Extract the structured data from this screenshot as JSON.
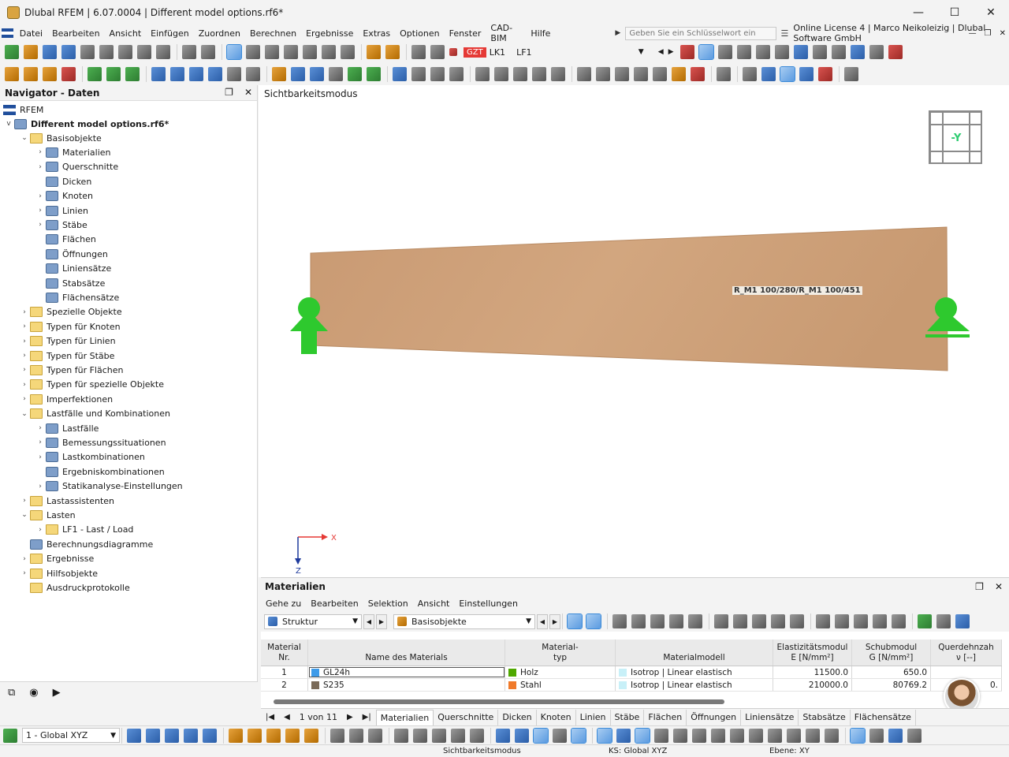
{
  "window": {
    "title": "Dlubal RFEM | 6.07.0004 | Different model options.rf6*",
    "controls": [
      "—",
      "☐",
      "✕"
    ]
  },
  "menu": {
    "items": [
      "Datei",
      "Bearbeiten",
      "Ansicht",
      "Einfügen",
      "Zuordnen",
      "Berechnen",
      "Ergebnisse",
      "Extras",
      "Optionen",
      "Fenster",
      "CAD-BIM",
      "Hilfe"
    ],
    "search_placeholder": "Geben Sie ein Schlüsselwort ein (Alt+Q)",
    "license": "Online License 4 | Marco Neikoleizig | Dlubal Software GmbH"
  },
  "toolbar": {
    "load_badge": "GZT",
    "load_case": "LK1",
    "load_name": "LF1"
  },
  "navigator": {
    "title": "Navigator - Daten",
    "root": "RFEM",
    "model": "Different model options.rf6*",
    "items": [
      {
        "label": "Basisobjekte",
        "level": 1,
        "chev": "v",
        "icon": "folder"
      },
      {
        "label": "Materialien",
        "level": 2,
        "chev": ">",
        "icon": "object"
      },
      {
        "label": "Querschnitte",
        "level": 2,
        "chev": ">",
        "icon": "object"
      },
      {
        "label": "Dicken",
        "level": 2,
        "chev": "",
        "icon": "object"
      },
      {
        "label": "Knoten",
        "level": 2,
        "chev": ">",
        "icon": "object"
      },
      {
        "label": "Linien",
        "level": 2,
        "chev": ">",
        "icon": "object"
      },
      {
        "label": "Stäbe",
        "level": 2,
        "chev": ">",
        "icon": "object"
      },
      {
        "label": "Flächen",
        "level": 2,
        "chev": "",
        "icon": "object"
      },
      {
        "label": "Öffnungen",
        "level": 2,
        "chev": "",
        "icon": "object"
      },
      {
        "label": "Liniensätze",
        "level": 2,
        "chev": "",
        "icon": "object"
      },
      {
        "label": "Stabsätze",
        "level": 2,
        "chev": "",
        "icon": "object"
      },
      {
        "label": "Flächensätze",
        "level": 2,
        "chev": "",
        "icon": "object"
      },
      {
        "label": "Spezielle Objekte",
        "level": 1,
        "chev": ">",
        "icon": "folder"
      },
      {
        "label": "Typen für Knoten",
        "level": 1,
        "chev": ">",
        "icon": "folder"
      },
      {
        "label": "Typen für Linien",
        "level": 1,
        "chev": ">",
        "icon": "folder"
      },
      {
        "label": "Typen für Stäbe",
        "level": 1,
        "chev": ">",
        "icon": "folder"
      },
      {
        "label": "Typen für Flächen",
        "level": 1,
        "chev": ">",
        "icon": "folder"
      },
      {
        "label": "Typen für spezielle Objekte",
        "level": 1,
        "chev": ">",
        "icon": "folder"
      },
      {
        "label": "Imperfektionen",
        "level": 1,
        "chev": ">",
        "icon": "folder"
      },
      {
        "label": "Lastfälle und Kombinationen",
        "level": 1,
        "chev": "v",
        "icon": "folder"
      },
      {
        "label": "Lastfälle",
        "level": 2,
        "chev": ">",
        "icon": "object"
      },
      {
        "label": "Bemessungssituationen",
        "level": 2,
        "chev": ">",
        "icon": "object"
      },
      {
        "label": "Lastkombinationen",
        "level": 2,
        "chev": ">",
        "icon": "object"
      },
      {
        "label": "Ergebniskombinationen",
        "level": 2,
        "chev": "",
        "icon": "object"
      },
      {
        "label": "Statikanalyse-Einstellungen",
        "level": 2,
        "chev": ">",
        "icon": "object"
      },
      {
        "label": "Lastassistenten",
        "level": 1,
        "chev": ">",
        "icon": "folder"
      },
      {
        "label": "Lasten",
        "level": 1,
        "chev": "v",
        "icon": "folder"
      },
      {
        "label": "LF1 - Last / Load",
        "level": 2,
        "chev": ">",
        "icon": "folder"
      },
      {
        "label": "Berechnungsdiagramme",
        "level": 1,
        "chev": "",
        "icon": "object"
      },
      {
        "label": "Ergebnisse",
        "level": 1,
        "chev": ">",
        "icon": "folder"
      },
      {
        "label": "Hilfsobjekte",
        "level": 1,
        "chev": ">",
        "icon": "folder"
      },
      {
        "label": "Ausdruckprotokolle",
        "level": 1,
        "chev": "",
        "icon": "folder"
      }
    ]
  },
  "viewport": {
    "mode_label": "Sichtbarkeitsmodus",
    "view_cube_face": "-Y",
    "member_label": "R_M1 100/280/R_M1 100/451",
    "axis_x": "X",
    "axis_z": "Z"
  },
  "materials_panel": {
    "title": "Materialien",
    "menu": [
      "Gehe zu",
      "Bearbeiten",
      "Selektion",
      "Ansicht",
      "Einstellungen"
    ],
    "combo_structure": "Struktur",
    "combo_objects": "Basisobjekte",
    "columns": [
      {
        "line1": "Material",
        "line2": "Nr."
      },
      {
        "line1": "",
        "line2": "Name des Materials"
      },
      {
        "line1": "Material-",
        "line2": "typ"
      },
      {
        "line1": "",
        "line2": "Materialmodell"
      },
      {
        "line1": "Elastizitätsmodul",
        "line2": "E [N/mm²]"
      },
      {
        "line1": "Schubmodul",
        "line2": "G [N/mm²]"
      },
      {
        "line1": "Querdehnzah",
        "line2": "ν [--]"
      }
    ],
    "rows": [
      {
        "no": "1",
        "name": "GL24h",
        "name_color": "#3d9be9",
        "type": "Holz",
        "type_color": "#4fa800",
        "model": "Isotrop | Linear elastisch",
        "model_color": "#c8f0f8",
        "e": "11500.0",
        "g": "650.0",
        "nu": ""
      },
      {
        "no": "2",
        "name": "S235",
        "name_color": "#7a6a58",
        "type": "Stahl",
        "type_color": "#f07a2a",
        "model": "Isotrop | Linear elastisch",
        "model_color": "#c8f0f8",
        "e": "210000.0",
        "g": "80769.2",
        "nu": "0."
      }
    ],
    "pager": "1 von 11",
    "tabs": [
      "Materialien",
      "Querschnitte",
      "Dicken",
      "Knoten",
      "Linien",
      "Stäbe",
      "Flächen",
      "Öffnungen",
      "Liniensätze",
      "Stabsätze",
      "Flächensätze"
    ]
  },
  "bottom_toolbar": {
    "cs_combo": "1 - Global XYZ"
  },
  "statusbar": {
    "mode": "Sichtbarkeitsmodus",
    "ks": "KS: Global XYZ",
    "plane": "Ebene: XY"
  }
}
